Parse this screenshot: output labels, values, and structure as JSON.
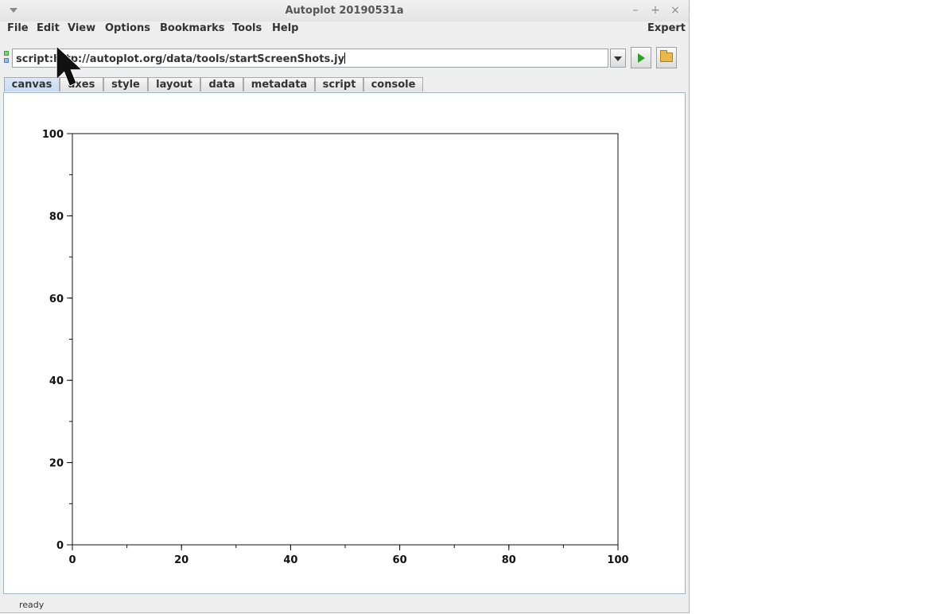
{
  "window": {
    "title": "Autoplot 20190531a",
    "menu_icon": "triangle-down-icon",
    "controls": {
      "minimize": "–",
      "maximize": "+",
      "close": "×"
    }
  },
  "menubar": {
    "items": [
      {
        "label": "File"
      },
      {
        "label": "Edit"
      },
      {
        "label": "View"
      },
      {
        "label": "Options"
      },
      {
        "label": "Bookmarks"
      },
      {
        "label": "Tools"
      },
      {
        "label": "Help"
      }
    ],
    "expert_label": "Expert"
  },
  "url_bar": {
    "value": "script:http://autoplot.org/data/tools/startScreenShots.jy",
    "status_colors": {
      "top": "#3aa13a",
      "bottom": "#4a7fbf"
    },
    "go_icon": "play-icon",
    "browse_icon": "folder-icon"
  },
  "tabs": [
    {
      "label": "canvas",
      "active": true
    },
    {
      "label": "axes",
      "active": false
    },
    {
      "label": "style",
      "active": false
    },
    {
      "label": "layout",
      "active": false
    },
    {
      "label": "data",
      "active": false
    },
    {
      "label": "metadata",
      "active": false
    },
    {
      "label": "script",
      "active": false
    },
    {
      "label": "console",
      "active": false
    }
  ],
  "chart_data": {
    "type": "scatter",
    "title": "",
    "xlabel": "",
    "ylabel": "",
    "xlim": [
      0,
      100
    ],
    "ylim": [
      0,
      100
    ],
    "x_ticks": [
      "0",
      "20",
      "40",
      "60",
      "80",
      "100"
    ],
    "y_ticks": [
      "0",
      "20",
      "40",
      "60",
      "80",
      "100"
    ],
    "grid": false,
    "series": []
  },
  "status": {
    "text": "ready"
  }
}
